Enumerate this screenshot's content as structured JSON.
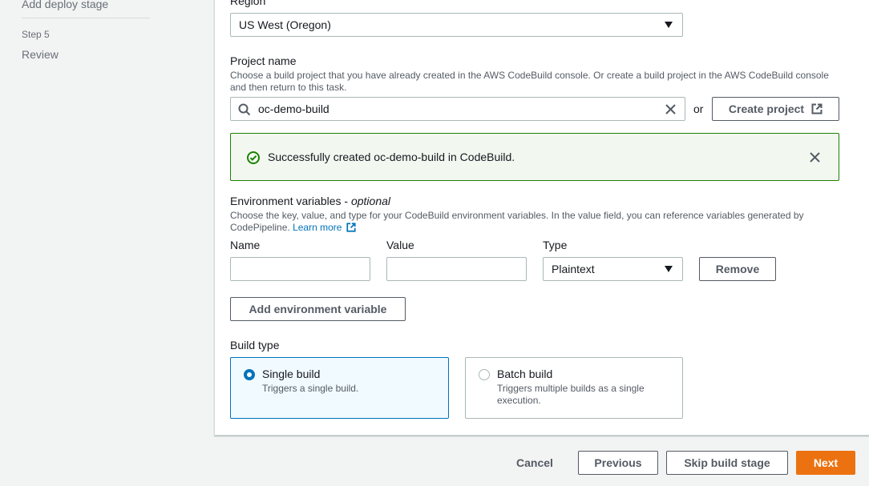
{
  "nav": {
    "prev_step_title": "Add deploy stage",
    "step5_label": "Step 5",
    "step5_title": "Review"
  },
  "region": {
    "label": "Region",
    "value": "US West (Oregon)"
  },
  "project": {
    "label": "Project name",
    "description": "Choose a build project that you have already created in the AWS CodeBuild console. Or create a build project in the AWS CodeBuild console and then return to this task.",
    "search_value": "oc-demo-build",
    "or_text": "or",
    "create_button": "Create project"
  },
  "alert": {
    "message": "Successfully created oc-demo-build in CodeBuild."
  },
  "env": {
    "label": "Environment variables",
    "label_suffix": " - ",
    "optional": "optional",
    "description": "Choose the key, value, and type for your CodeBuild environment variables. In the value field, you can reference variables generated by CodePipeline.",
    "learn_more": "Learn more",
    "name_header": "Name",
    "value_header": "Value",
    "type_header": "Type",
    "name_value": "",
    "value_value": "",
    "type_value": "Plaintext",
    "remove_button": "Remove",
    "add_button": "Add environment variable"
  },
  "build_type": {
    "label": "Build type",
    "options": [
      {
        "title": "Single build",
        "description": "Triggers a single build.",
        "selected": true
      },
      {
        "title": "Batch build",
        "description": "Triggers multiple builds as a single execution.",
        "selected": false
      }
    ]
  },
  "footer": {
    "cancel": "Cancel",
    "previous": "Previous",
    "skip": "Skip build stage",
    "next": "Next"
  },
  "colors": {
    "primary": "#ec7211",
    "success": "#1d8102",
    "link": "#0073bb"
  }
}
